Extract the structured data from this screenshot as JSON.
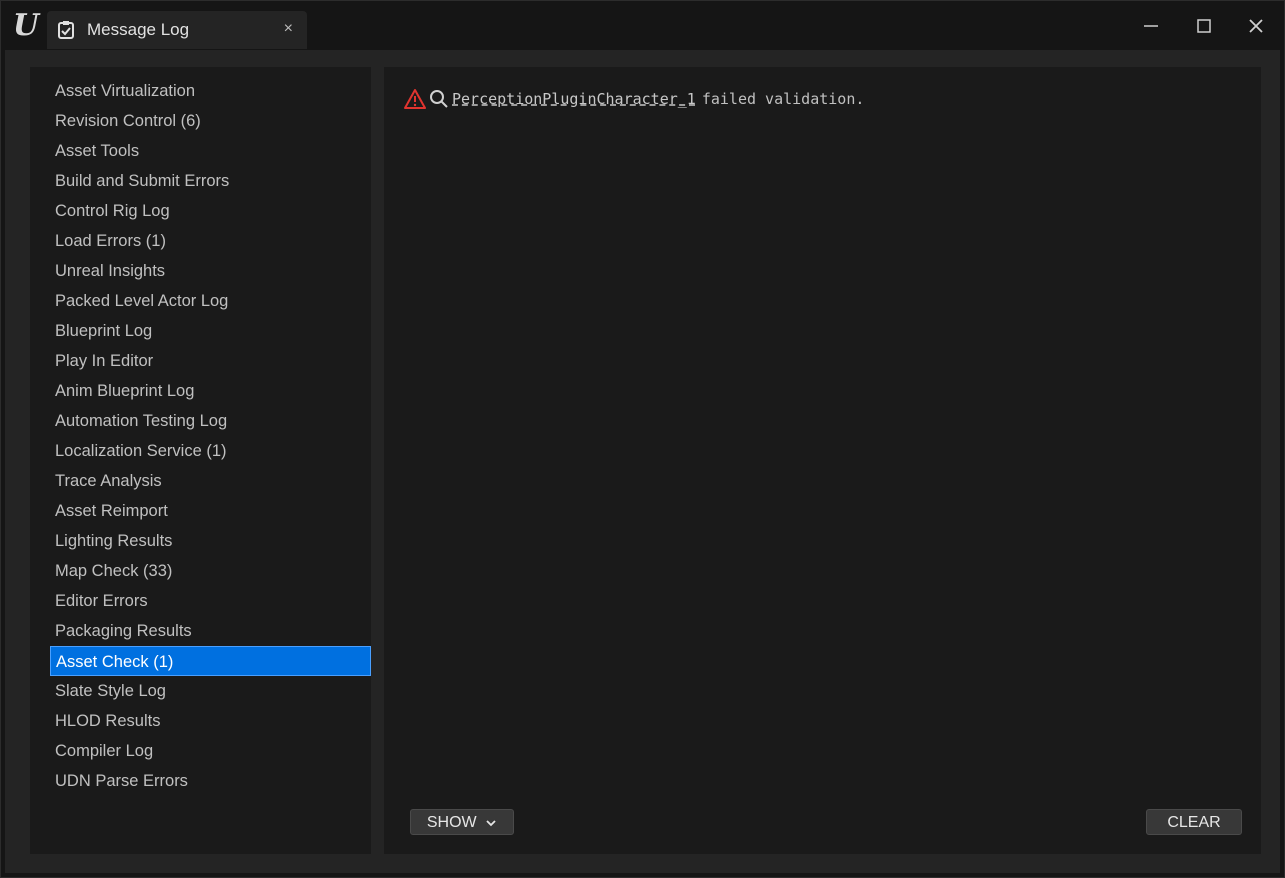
{
  "window": {
    "tab_title": "Message Log",
    "tab_close": "×",
    "logo": "U"
  },
  "categories": [
    "Asset Virtualization",
    "Revision Control (6)",
    "Asset Tools",
    "Build and Submit Errors",
    "Control Rig Log",
    "Load Errors (1)",
    "Unreal Insights",
    "Packed Level Actor Log",
    "Blueprint Log",
    "Play In Editor",
    "Anim Blueprint Log",
    "Automation Testing Log",
    "Localization Service (1)",
    "Trace Analysis",
    "Asset Reimport",
    "Lighting Results",
    "Map Check (33)",
    "Editor Errors",
    "Packaging Results",
    "Asset Check (1)",
    "Slate Style Log",
    "HLOD Results",
    "Compiler Log",
    "UDN Parse Errors"
  ],
  "selected_category": "Asset Check (1)",
  "message": {
    "severity_icon": "warning-icon",
    "link": "PerceptionPluginCharacter_1",
    "text": "failed validation."
  },
  "buttons": {
    "show": "SHOW",
    "clear": "CLEAR"
  },
  "colors": {
    "selected": "#0070e0",
    "warning": "#e0342f"
  }
}
